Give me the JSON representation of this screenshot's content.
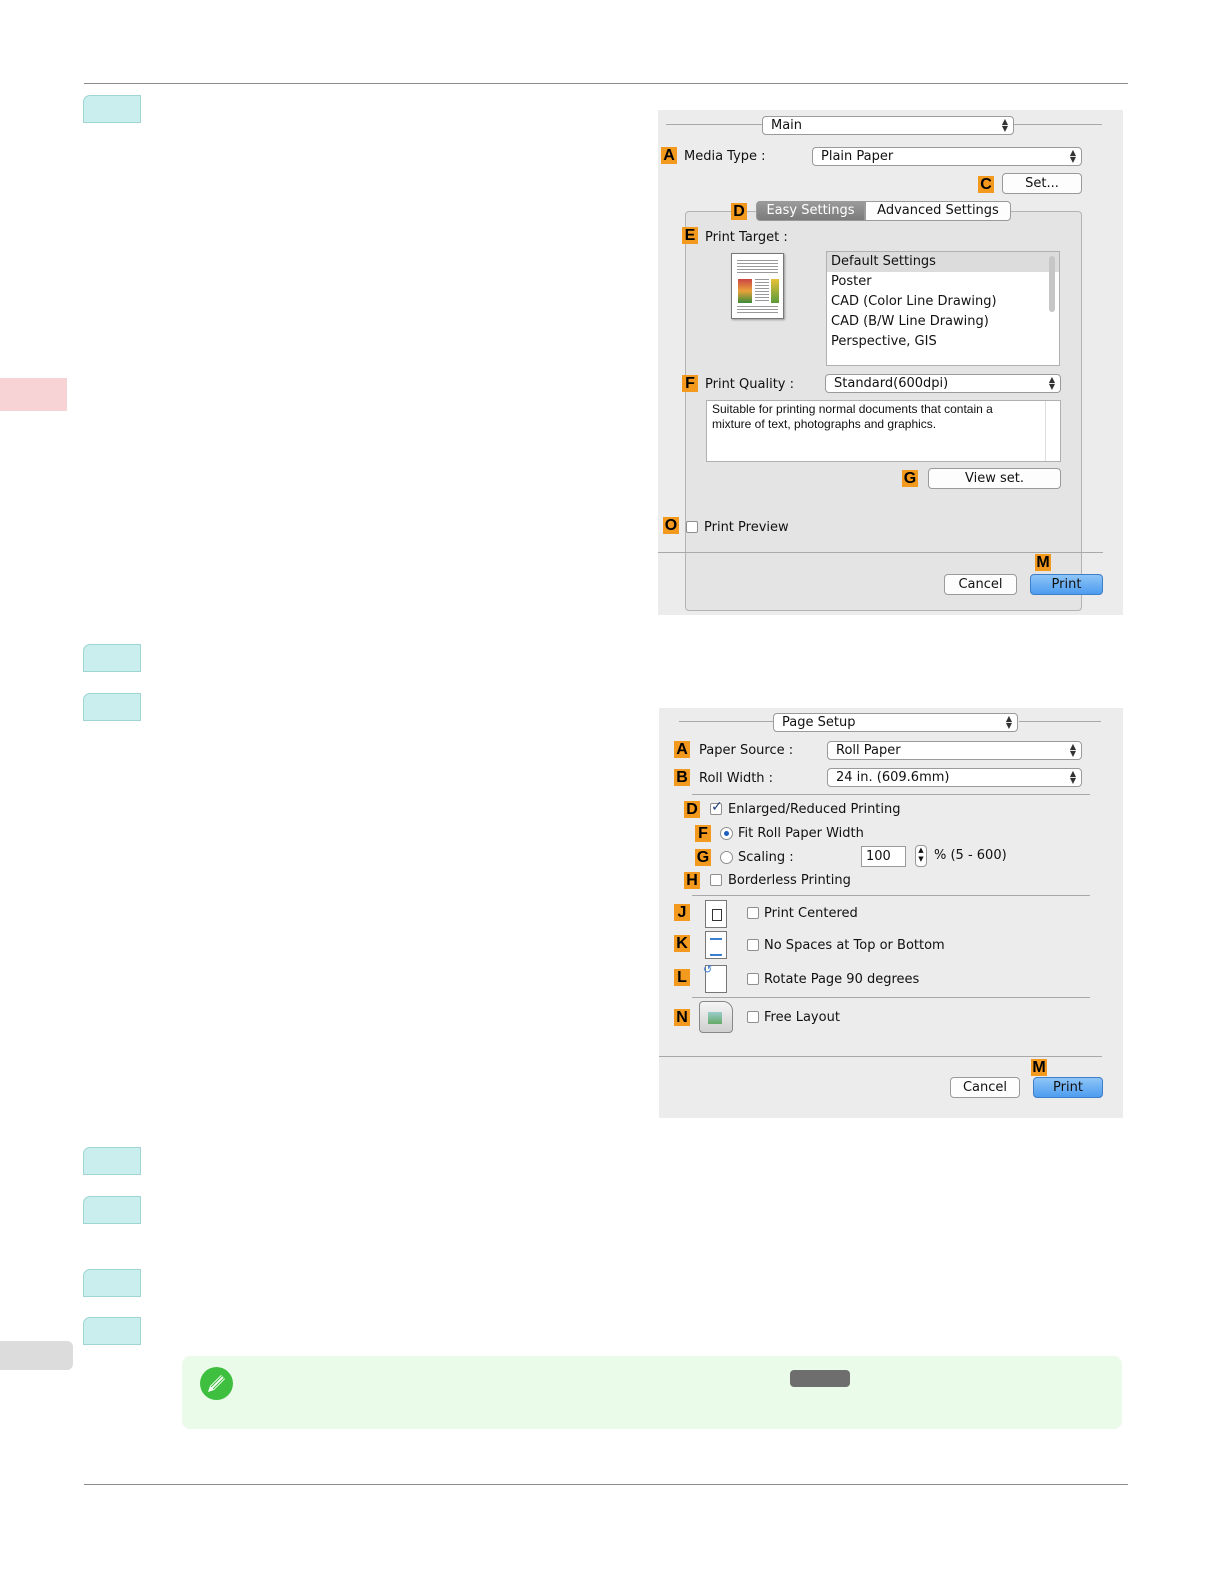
{
  "dialog1": {
    "panel_popup": "Main",
    "media_type_label": "Media Type :",
    "media_type_value": "Plain Paper",
    "set_button": "Set...",
    "tabs": [
      "Easy Settings",
      "Advanced Settings"
    ],
    "print_target_label": "Print Target :",
    "print_targets": [
      "Default Settings",
      "Poster",
      "CAD (Color Line Drawing)",
      "CAD (B/W Line Drawing)",
      "Perspective, GIS"
    ],
    "print_quality_label": "Print Quality :",
    "print_quality_value": "Standard(600dpi)",
    "quality_description": "Suitable for printing normal documents that contain a mixture of text, photographs and graphics.",
    "view_set_button": "View set.",
    "print_preview_label": "Print Preview",
    "cancel_button": "Cancel",
    "print_button": "Print",
    "markers": {
      "a": "A",
      "c": "C",
      "d": "D",
      "e": "E",
      "f": "F",
      "g": "G",
      "o": "O",
      "m": "M"
    }
  },
  "dialog2": {
    "panel_popup": "Page Setup",
    "paper_source_label": "Paper Source :",
    "paper_source_value": "Roll Paper",
    "roll_width_label": "Roll Width :",
    "roll_width_value": "24 in. (609.6mm)",
    "enlarged_label": "Enlarged/Reduced Printing",
    "fit_roll_label": "Fit Roll Paper Width",
    "scaling_label": "Scaling :",
    "scaling_value": "100",
    "scaling_range": "% (5 - 600)",
    "borderless_label": "Borderless Printing",
    "print_centered_label": "Print Centered",
    "no_spaces_label": "No Spaces at Top or Bottom",
    "rotate_label": "Rotate Page 90 degrees",
    "free_layout_label": "Free Layout",
    "cancel_button": "Cancel",
    "print_button": "Print",
    "markers": {
      "a": "A",
      "b": "B",
      "d": "D",
      "f": "F",
      "g": "G",
      "h": "H",
      "j": "J",
      "k": "K",
      "l": "L",
      "n": "N",
      "m": "M"
    }
  },
  "colors": {
    "step_tab": "#c9eeed",
    "note_bg": "#eafbe9",
    "marker": "#f39a1e",
    "print_button": "#4d9cf0"
  },
  "icons": [
    "pencil-note-icon"
  ]
}
